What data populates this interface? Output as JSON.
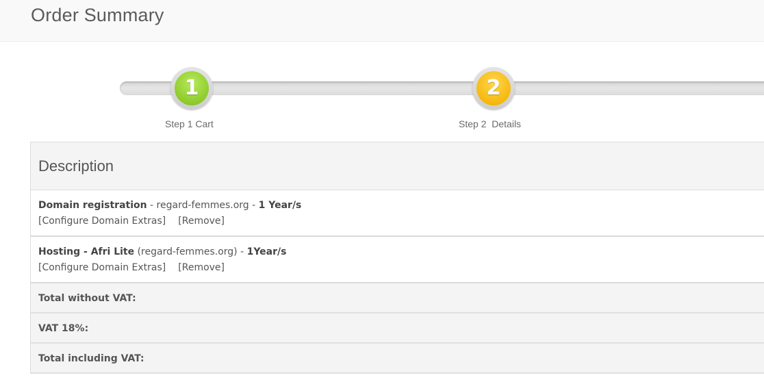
{
  "header": {
    "title": "Order Summary"
  },
  "steps": [
    {
      "number": "1",
      "label": "Step 1 Cart",
      "color": "#8ecb2c"
    },
    {
      "number": "2",
      "label": "Step 2  Details",
      "color": "#f6b90e"
    }
  ],
  "table": {
    "header": "Description",
    "items": [
      {
        "name": "Domain registration",
        "sep1": " - ",
        "detail": "regard-femmes.org",
        "sep2": " - ",
        "period": "1 Year/s",
        "configure_label": "[Configure Domain Extras]",
        "remove_label": "[Remove]"
      },
      {
        "name": "Hosting - Afri Lite",
        "sep1": " ",
        "detail": "(regard-femmes.org)",
        "sep2": " - ",
        "period": "1Year/s",
        "configure_label": "[Configure Domain Extras]",
        "remove_label": "[Remove]"
      }
    ],
    "totals": [
      {
        "label": "Total without VAT:"
      },
      {
        "label": "VAT 18%:"
      },
      {
        "label": "Total including VAT:"
      }
    ]
  }
}
